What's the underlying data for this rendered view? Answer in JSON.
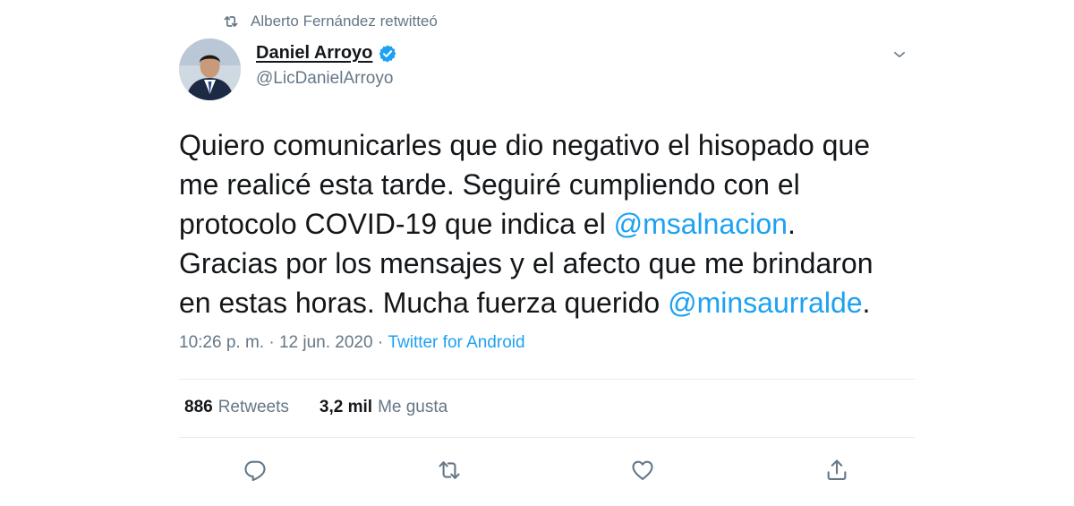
{
  "retweet_context": {
    "text": "Alberto Fernández retwitteó"
  },
  "author": {
    "display_name": "Daniel Arroyo",
    "handle": "@LicDanielArroyo",
    "verified": true
  },
  "tweet": {
    "line1": "Quiero comunicarles que dio negativo el hisopado que",
    "line2": "me realicé esta tarde. Seguiré cumpliendo con el",
    "line3_pre": "protocolo COVID-19 que indica el ",
    "mention1": "@msalnacion",
    "line3_post": ".",
    "line4": "Gracias por los mensajes y el afecto que me brindaron",
    "line5_pre": "en estas horas. Mucha fuerza querido ",
    "mention2": "@minsaurralde",
    "line5_post": "."
  },
  "meta": {
    "time": "10:26 p. m.",
    "separator1": " · ",
    "date": "12 jun. 2020",
    "separator2": " · ",
    "source": "Twitter for Android"
  },
  "stats": {
    "retweets_count": "886",
    "retweets_label": "Retweets",
    "likes_count": "3,2 mil",
    "likes_label": "Me gusta"
  },
  "colors": {
    "accent": "#1da1f2",
    "secondary_text": "#657786",
    "divider": "#e6ecf0"
  },
  "icons": {
    "retweet_context": "retweet-icon",
    "verified": "verified-badge-icon",
    "caret": "chevron-down-icon",
    "reply": "reply-icon",
    "retweet": "retweet-icon",
    "like": "heart-icon",
    "share": "share-icon"
  }
}
